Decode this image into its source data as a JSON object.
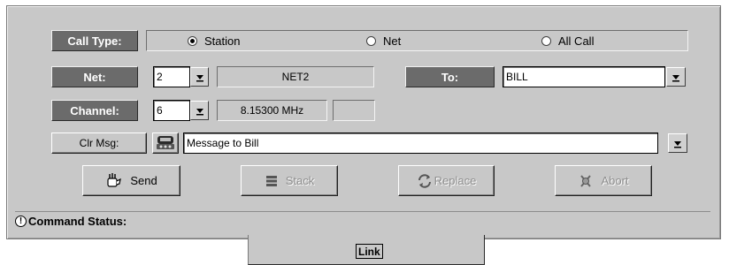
{
  "call_type": {
    "label": "Call Type:",
    "options": [
      {
        "label": "Station",
        "selected": true
      },
      {
        "label": "Net",
        "selected": false
      },
      {
        "label": "All Call",
        "selected": false
      }
    ]
  },
  "net": {
    "label": "Net:",
    "value": "2",
    "display": "NET2"
  },
  "to": {
    "label": "To:",
    "value": "BILL"
  },
  "channel": {
    "label": "Channel:",
    "value": "6",
    "frequency": "8.15300 MHz",
    "extra": ""
  },
  "message": {
    "clear_label": "Clr Msg:",
    "value": "Message to Bill"
  },
  "buttons": {
    "send": {
      "label": "Send",
      "enabled": true
    },
    "stack": {
      "label": "Stack",
      "enabled": false
    },
    "replace": {
      "label": "Replace",
      "enabled": false
    },
    "abort": {
      "label": "Abort",
      "enabled": false
    }
  },
  "status": {
    "label": "Command Status:"
  },
  "tab": {
    "label": "Link"
  },
  "icons": {
    "dropdown": "dropdown-arrow-icon",
    "radio": "radio-button-icon",
    "message_template": "radio-operator-icon",
    "send": "send-hand-icon",
    "stack": "stack-icon",
    "replace": "replace-arrows-icon",
    "abort": "abort-icon",
    "status": "exclamation-icon"
  }
}
